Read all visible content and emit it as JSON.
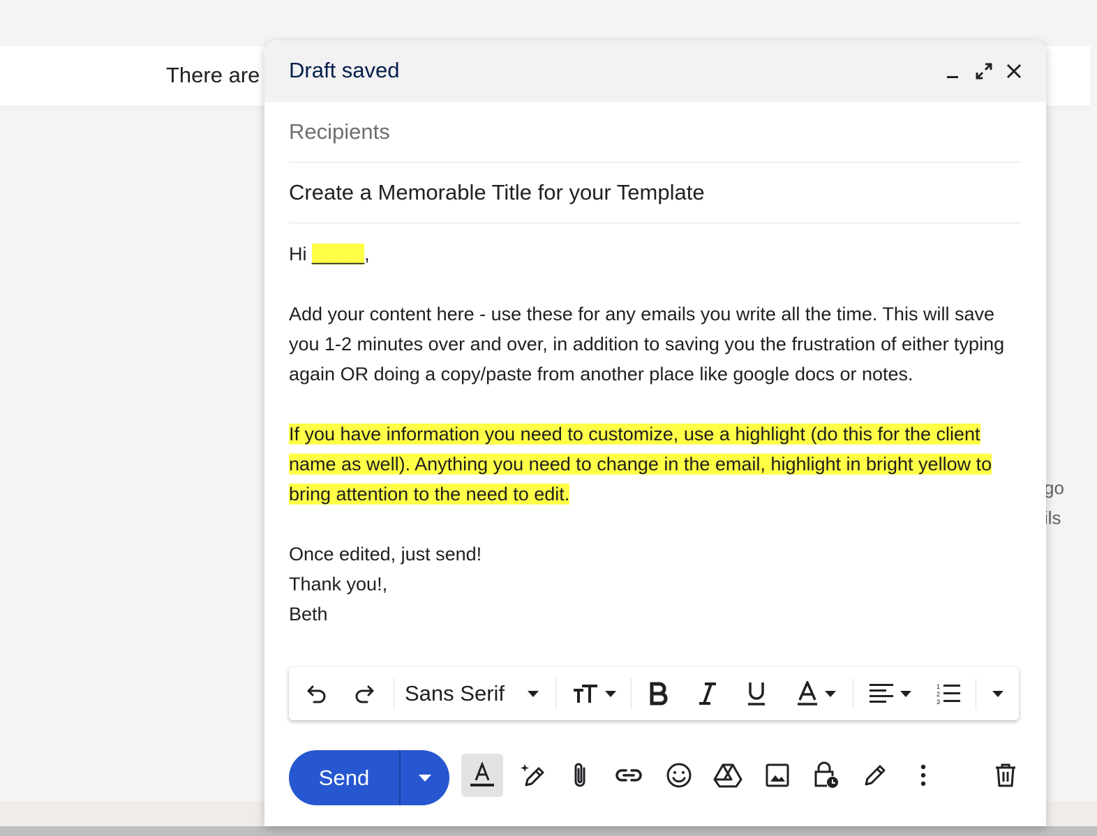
{
  "background": {
    "banner_text": "There are",
    "right_partial_1": "go",
    "right_partial_2": "ils"
  },
  "compose": {
    "title": "Draft saved",
    "recipients_placeholder": "Recipients",
    "subject": "Create a Memorable Title for your Template",
    "body": {
      "greeting_prefix": "Hi ",
      "greeting_blank": "_____",
      "greeting_suffix": ",",
      "paragraph1": "Add your content here - use these for any emails you write all the time. This will save you 1-2 minutes over and over, in addition to saving you the frustration of either typing again OR doing a copy/paste from another place like google docs or notes.",
      "paragraph2_highlighted": "If you have information you need to customize, use a highlight (do this for the client name as well). Anything you need to change in the email, highlight in bright yellow to bring attention to the need to edit.",
      "closing_line1": "Once edited, just send!",
      "closing_line2": "Thank you!,",
      "signature": "Beth"
    },
    "formatting": {
      "font_family": "Sans Serif"
    },
    "send_label": "Send"
  },
  "colors": {
    "send_button": "#2657d0",
    "highlight": "#ffff47",
    "header_title": "#041e49"
  }
}
